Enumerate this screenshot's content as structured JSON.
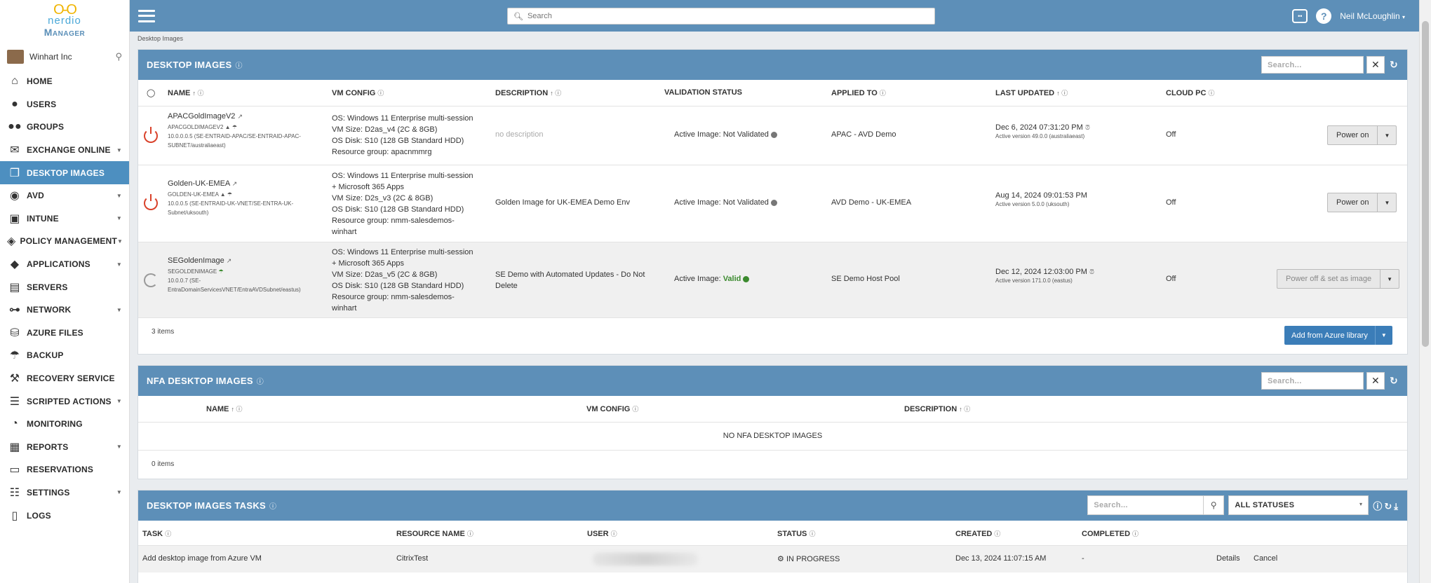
{
  "brand": {
    "mark": "O-O",
    "name": "nerdio",
    "product": "Manager"
  },
  "org": {
    "name": "Winhart Inc"
  },
  "nav": [
    {
      "key": "home",
      "label": "HOME",
      "icon": "home-icon",
      "glyph": "⌂",
      "caret": false,
      "active": false
    },
    {
      "key": "users",
      "label": "USERS",
      "icon": "user-icon",
      "glyph": "●",
      "caret": false,
      "active": false
    },
    {
      "key": "groups",
      "label": "GROUPS",
      "icon": "groups-icon",
      "glyph": "●●",
      "caret": false,
      "active": false
    },
    {
      "key": "exchange-online",
      "label": "EXCHANGE ONLINE",
      "icon": "envelope-icon",
      "glyph": "✉",
      "caret": true,
      "active": false
    },
    {
      "key": "desktop-images",
      "label": "DESKTOP IMAGES",
      "icon": "copy-icon",
      "glyph": "❐",
      "caret": false,
      "active": true
    },
    {
      "key": "avd",
      "label": "AVD",
      "icon": "avd-icon",
      "glyph": "◉",
      "caret": true,
      "active": false
    },
    {
      "key": "intune",
      "label": "INTUNE",
      "icon": "devices-icon",
      "glyph": "▣",
      "caret": true,
      "active": false
    },
    {
      "key": "policy-management",
      "label": "POLICY MANAGEMENT",
      "icon": "shield-icon",
      "glyph": "◈",
      "caret": true,
      "active": false
    },
    {
      "key": "applications",
      "label": "APPLICATIONS",
      "icon": "box-icon",
      "glyph": "◆",
      "caret": true,
      "active": false
    },
    {
      "key": "servers",
      "label": "SERVERS",
      "icon": "server-icon",
      "glyph": "▤",
      "caret": false,
      "active": false
    },
    {
      "key": "network",
      "label": "NETWORK",
      "icon": "network-icon",
      "glyph": "⊶",
      "caret": true,
      "active": false
    },
    {
      "key": "azure-files",
      "label": "AZURE FILES",
      "icon": "database-icon",
      "glyph": "⛁",
      "caret": false,
      "active": false
    },
    {
      "key": "backup",
      "label": "BACKUP",
      "icon": "umbrella-icon",
      "glyph": "☂",
      "caret": false,
      "active": false
    },
    {
      "key": "recovery-service",
      "label": "RECOVERY SERVICE",
      "icon": "hammer-icon",
      "glyph": "⚒",
      "caret": false,
      "active": false
    },
    {
      "key": "scripted-actions",
      "label": "SCRIPTED ACTIONS",
      "icon": "list-icon",
      "glyph": "☰",
      "caret": true,
      "active": false
    },
    {
      "key": "monitoring",
      "label": "MONITORING",
      "icon": "gauge-icon",
      "glyph": "◔",
      "caret": false,
      "active": false
    },
    {
      "key": "reports",
      "label": "REPORTS",
      "icon": "table-icon",
      "glyph": "▦",
      "caret": true,
      "active": false
    },
    {
      "key": "reservations",
      "label": "RESERVATIONS",
      "icon": "ticket-icon",
      "glyph": "▭",
      "caret": false,
      "active": false
    },
    {
      "key": "settings",
      "label": "SETTINGS",
      "icon": "sliders-icon",
      "glyph": "☷",
      "caret": true,
      "active": false
    },
    {
      "key": "logs",
      "label": "LOGS",
      "icon": "file-icon",
      "glyph": "▯",
      "caret": false,
      "active": false
    }
  ],
  "topbar": {
    "search_placeholder": "Search",
    "user": "Neil McLoughlin"
  },
  "breadcrumb": "Desktop Images",
  "desktop_images": {
    "title": "DESKTOP IMAGES",
    "search_placeholder": "Search...",
    "columns": {
      "name": "NAME",
      "vm_config": "VM CONFIG",
      "description": "DESCRIPTION",
      "validation": "VALIDATION STATUS",
      "applied_to": "APPLIED TO",
      "last_updated": "LAST UPDATED",
      "cloud_pc": "CLOUD PC"
    },
    "rows": [
      {
        "name": "APACGoldImageV2",
        "subname": "APACGOLDIMAGEV2",
        "network": "10.0.0.0.5 (SE-ENTRAID-APAC/SE-ENTRAID-APAC-",
        "network2": "SUBNET/australiaeast)",
        "vm1": "OS: Windows 11 Enterprise multi-session",
        "vm2": "VM Size: D2as_v4 (2C & 8GB)",
        "vm3": "OS Disk: S10 (128 GB Standard HDD)",
        "vm4": "Resource group: apacnmmrg",
        "vm5": "",
        "description": "no description",
        "validation_prefix": "Active Image:",
        "validation_status": "Not Validated",
        "applied_to": "APAC - AVD Demo",
        "updated": "Dec 6, 2024 07:31:20 PM",
        "version": "Active version 49.0.0 (australiaeast)",
        "cloud_pc": "Off",
        "action": "Power on"
      },
      {
        "name": "Golden-UK-EMEA",
        "subname": "GOLDEN-UK-EMEA",
        "network": "10.0.0.5 (SE-ENTRAID-UK-VNET/SE-ENTRA-UK-",
        "network2": "Subnet/uksouth)",
        "vm1": "OS: Windows 11 Enterprise multi-session",
        "vm2": "+ Microsoft 365 Apps",
        "vm3": "VM Size: D2s_v3 (2C & 8GB)",
        "vm4": "OS Disk: S10 (128 GB Standard HDD)",
        "vm5": "Resource group: nmm-salesdemos-",
        "vm6": "winhart",
        "description": "Golden Image for UK-EMEA Demo Env",
        "validation_prefix": "Active Image:",
        "validation_status": "Not Validated",
        "applied_to": "AVD Demo - UK-EMEA",
        "updated": "Aug 14, 2024 09:01:53 PM",
        "version": "Active version 5.0.0 (uksouth)",
        "cloud_pc": "Off",
        "action": "Power on"
      },
      {
        "name": "SEGoldenImage",
        "subname": "SEGOLDENIMAGE",
        "network": "10.0.0.7 (SE-",
        "network2": "EntraDomainServicesVNET/EntraAVDSubnet/eastus)",
        "vm1": "OS: Windows 11 Enterprise multi-session",
        "vm2": "+ Microsoft 365 Apps",
        "vm3": "VM Size: D2as_v5 (2C & 8GB)",
        "vm4": "OS Disk: S10 (128 GB Standard HDD)",
        "vm5": "Resource group: nmm-salesdemos-",
        "vm6": "winhart",
        "description": "SE Demo with Automated Updates - Do Not",
        "description2": "Delete",
        "validation_prefix": "Active Image:",
        "validation_status": "Valid",
        "applied_to": "SE Demo Host Pool",
        "updated": "Dec 12, 2024 12:03:00 PM",
        "version": "Active version 171.0.0 (eastus)",
        "cloud_pc": "Off",
        "action": "Power off & set as image"
      }
    ],
    "count": "3 items",
    "add_button": "Add from Azure library"
  },
  "nfa_images": {
    "title": "NFA DESKTOP IMAGES",
    "search_placeholder": "Search...",
    "columns": {
      "name": "NAME",
      "vm_config": "VM CONFIG",
      "description": "DESCRIPTION"
    },
    "empty": "NO NFA DESKTOP IMAGES",
    "count": "0 items"
  },
  "tasks": {
    "title": "DESKTOP IMAGES TASKS",
    "search_placeholder": "Search...",
    "status_filter": "ALL STATUSES",
    "columns": {
      "task": "TASK",
      "resource": "RESOURCE NAME",
      "user": "USER",
      "status": "STATUS",
      "created": "CREATED",
      "completed": "COMPLETED"
    },
    "rows": [
      {
        "task": "Add desktop image from Azure VM",
        "resource": "CitrixTest",
        "status": "IN PROGRESS",
        "created": "Dec 13, 2024 11:07:15 AM",
        "completed": "-",
        "details": "Details",
        "cancel": "Cancel"
      }
    ]
  }
}
